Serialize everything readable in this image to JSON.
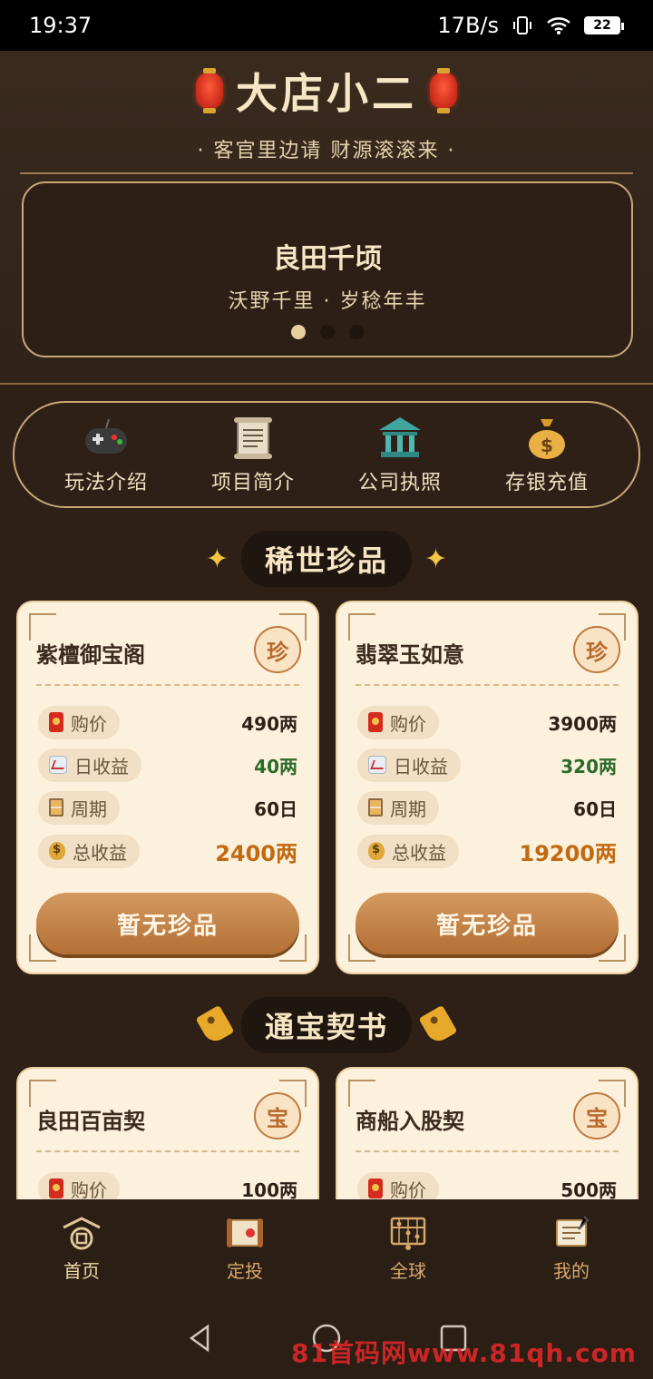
{
  "status_bar": {
    "time": "19:37",
    "speed": "17B/s",
    "battery": "22"
  },
  "header": {
    "title": "大店小二",
    "subtitle": "· 客官里边请 财源滚滚来 ·",
    "banner": {
      "title": "良田千顷",
      "subtitle": "沃野千里 · 岁稔年丰",
      "active_dot": 0
    }
  },
  "quick_nav": [
    {
      "label": "玩法介绍",
      "icon": "gamepad-icon"
    },
    {
      "label": "项目简介",
      "icon": "scroll-icon"
    },
    {
      "label": "公司执照",
      "icon": "bank-icon"
    },
    {
      "label": "存银充值",
      "icon": "money-bag-icon"
    }
  ],
  "sections": {
    "rare": {
      "title": "稀世珍品"
    },
    "contracts": {
      "title": "通宝契书"
    }
  },
  "rare_cards": [
    {
      "name": "紫檀御宝阁",
      "badge": "珍",
      "price_label": "购价",
      "price": "490两",
      "daily_label": "日收益",
      "daily": "40两",
      "period_label": "周期",
      "period": "60日",
      "total_label": "总收益",
      "total": "2400两",
      "button": "暂无珍品"
    },
    {
      "name": "翡翠玉如意",
      "badge": "珍",
      "price_label": "购价",
      "price": "3900两",
      "daily_label": "日收益",
      "daily": "320两",
      "period_label": "周期",
      "period": "60日",
      "total_label": "总收益",
      "total": "19200两",
      "button": "暂无珍品"
    }
  ],
  "contract_cards": [
    {
      "name": "良田百亩契",
      "badge": "宝",
      "price_label": "购价",
      "price": "100两"
    },
    {
      "name": "商船入股契",
      "badge": "宝",
      "price_label": "购价",
      "price": "500两"
    }
  ],
  "tabs": [
    {
      "label": "首页",
      "icon": "home-icon",
      "active": true
    },
    {
      "label": "定投",
      "icon": "scroll-invest-icon"
    },
    {
      "label": "全球",
      "icon": "abacus-icon"
    },
    {
      "label": "我的",
      "icon": "notebook-icon"
    }
  ],
  "watermark": "81首码网www.81qh.com"
}
